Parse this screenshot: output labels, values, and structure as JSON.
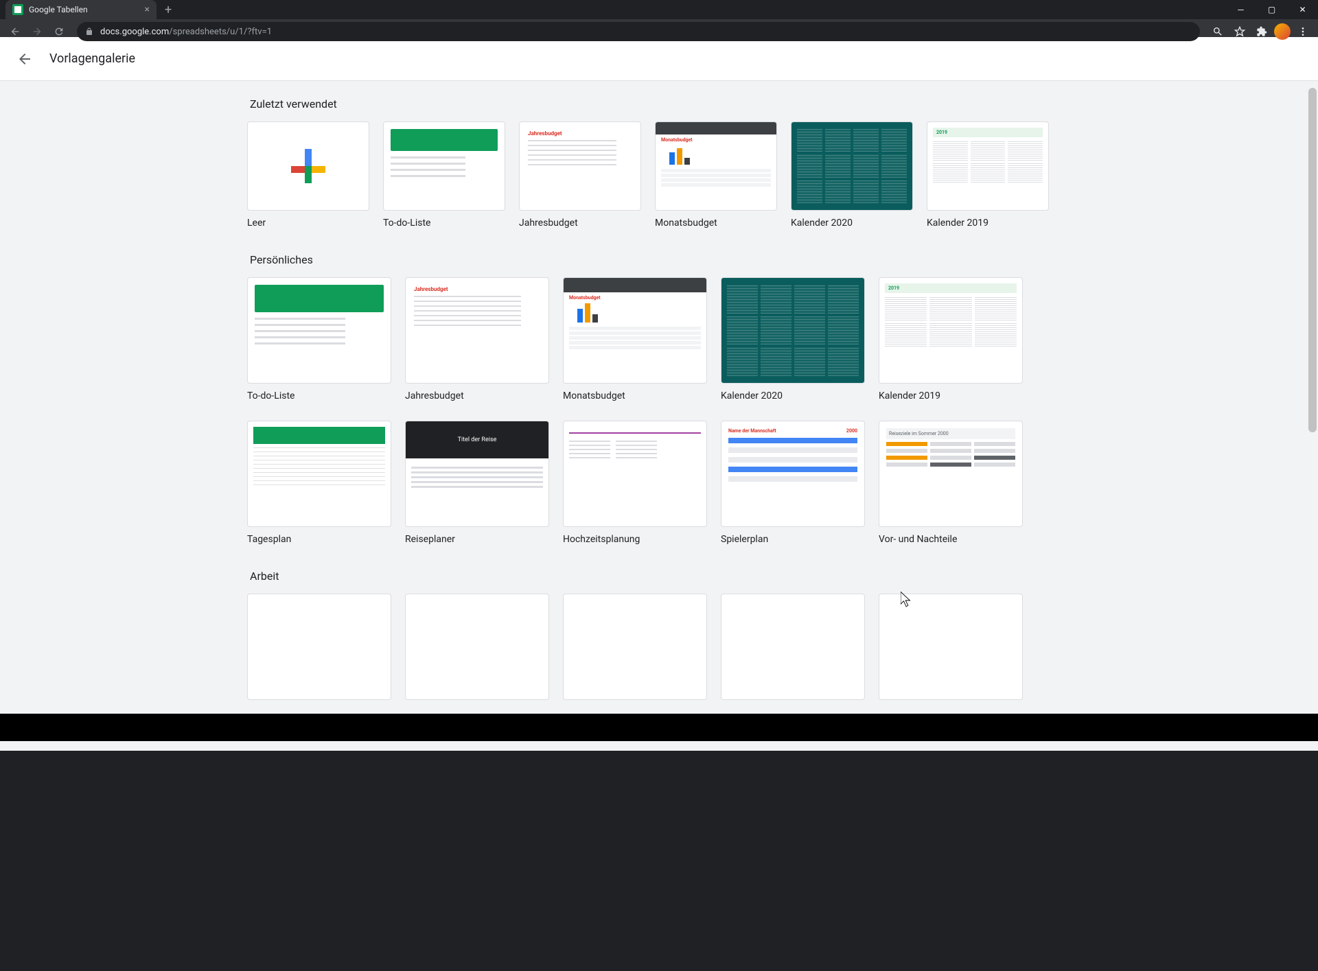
{
  "browser": {
    "tab_title": "Google Tabellen",
    "url_host": "docs.google.com",
    "url_path": "/spreadsheets/u/1/?ftv=1"
  },
  "page": {
    "title": "Vorlagengalerie"
  },
  "sections": {
    "recent": {
      "title": "Zuletzt verwendet",
      "items": [
        {
          "label": "Leer"
        },
        {
          "label": "To-do-Liste"
        },
        {
          "label": "Jahresbudget"
        },
        {
          "label": "Monatsbudget"
        },
        {
          "label": "Kalender 2020"
        },
        {
          "label": "Kalender 2019"
        }
      ]
    },
    "personal": {
      "title": "Persönliches",
      "row1": [
        {
          "label": "To-do-Liste"
        },
        {
          "label": "Jahresbudget"
        },
        {
          "label": "Monatsbudget"
        },
        {
          "label": "Kalender 2020"
        },
        {
          "label": "Kalender 2019"
        }
      ],
      "row2": [
        {
          "label": "Tagesplan"
        },
        {
          "label": "Reiseplaner"
        },
        {
          "label": "Hochzeitsplanung"
        },
        {
          "label": "Spielerplan"
        },
        {
          "label": "Vor- und Nachteile"
        }
      ]
    },
    "work": {
      "title": "Arbeit"
    }
  },
  "thumbs": {
    "annual_title": "Jahresbudget",
    "monthly_title": "Monatsbudget",
    "cal2019_year": "2019",
    "reise_title": "Titel der Reise",
    "spieler_team": "Name der Mannschaft",
    "spieler_year": "2000",
    "vornach_title": "Reiseziele im Sommer 2000"
  }
}
